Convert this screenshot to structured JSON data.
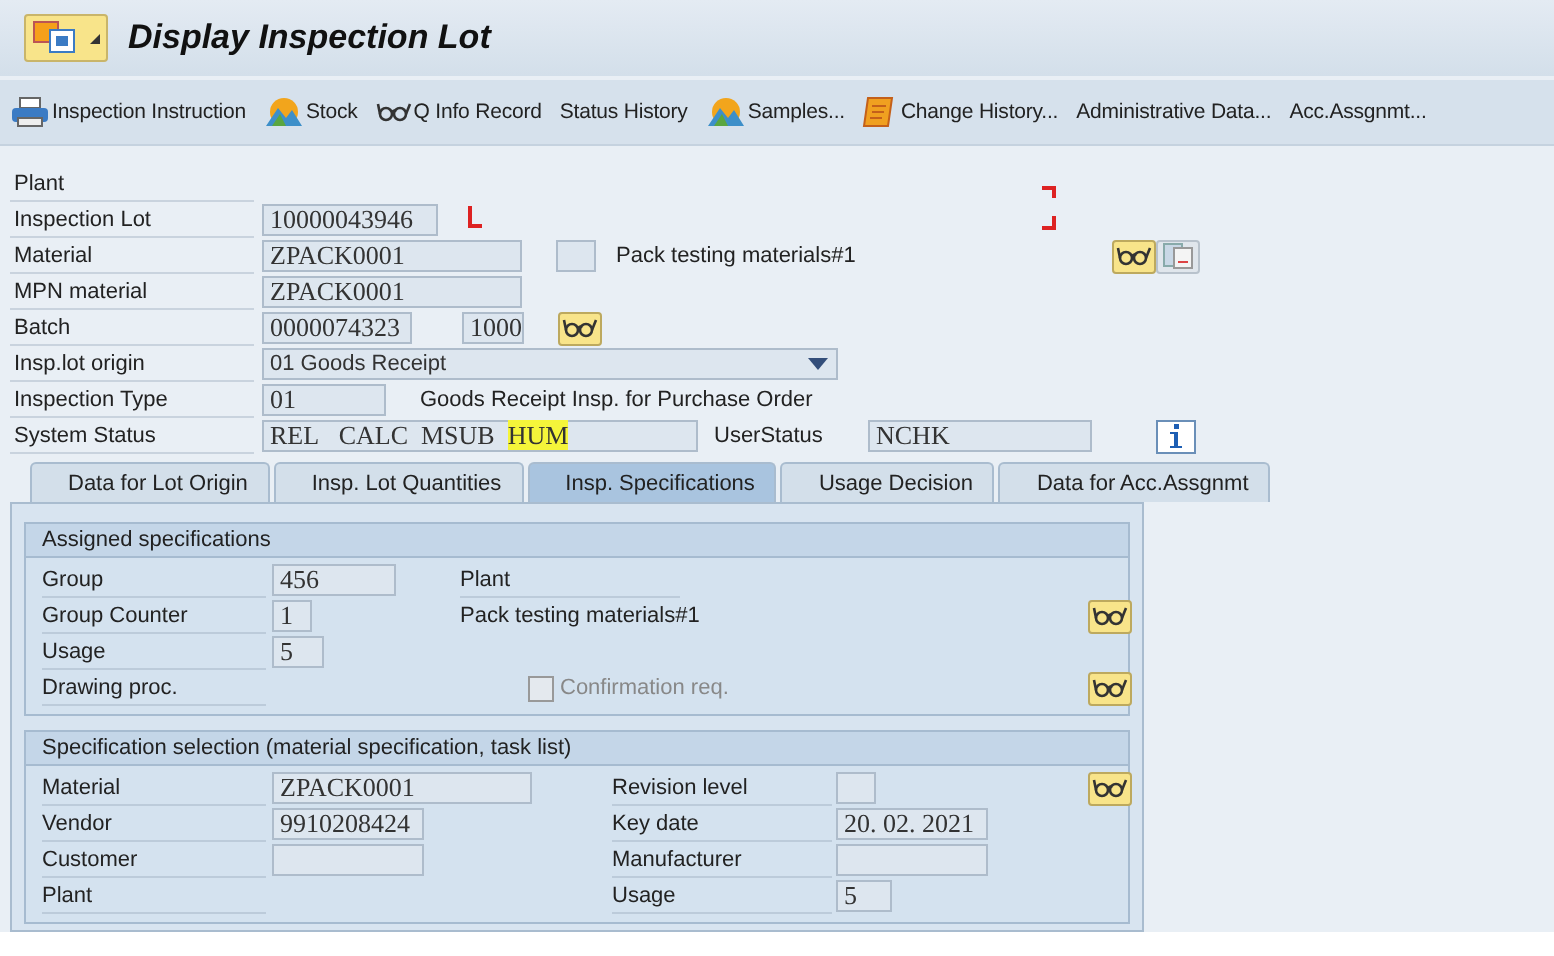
{
  "window": {
    "title": "Display Inspection Lot"
  },
  "toolbar": [
    {
      "label": "Inspection Instruction",
      "kind": "printer"
    },
    {
      "label": "Stock",
      "kind": "mountain"
    },
    {
      "label": "Q Info Record",
      "kind": "glasses"
    },
    {
      "label": "Status History"
    },
    {
      "label": "Samples...",
      "kind": "mountain"
    },
    {
      "label": "Change History...",
      "kind": "scroll"
    },
    {
      "label": "Administrative Data..."
    },
    {
      "label": "Acc.Assgnmt..."
    }
  ],
  "header": {
    "plant": {
      "label": "Plant"
    },
    "inspection_lot": {
      "label": "Inspection Lot",
      "value": "10000043946"
    },
    "material": {
      "label": "Material",
      "value": "ZPACK0001",
      "description": "Pack testing materials#1"
    },
    "mpn_material": {
      "label": "MPN material",
      "value": "ZPACK0001"
    },
    "batch": {
      "label": "Batch",
      "value": "0000074323",
      "plant_value": "1000"
    },
    "insp_lot_origin": {
      "label": "Insp.lot origin",
      "value": "01 Goods Receipt"
    },
    "inspection_type": {
      "label": "Inspection Type",
      "value": "01",
      "description": "Goods Receipt Insp. for Purchase Order"
    },
    "system_status": {
      "label": "System Status",
      "statuses": [
        {
          "text": "REL",
          "highlighted": false
        },
        {
          "text": "CALC",
          "highlighted": false
        },
        {
          "text": "MSUB",
          "highlighted": false
        },
        {
          "text": "HUM",
          "highlighted": true
        }
      ]
    },
    "user_status": {
      "label": "UserStatus",
      "value": "NCHK"
    }
  },
  "tabs": [
    {
      "label": "Data for Lot Origin",
      "selected": false
    },
    {
      "label": "Insp. Lot Quantities",
      "selected": false
    },
    {
      "label": "Insp. Specifications",
      "selected": true
    },
    {
      "label": "Usage Decision",
      "selected": false
    },
    {
      "label": "Data for Acc.Assgnmt",
      "selected": false
    }
  ],
  "assigned_specifications": {
    "title": "Assigned specifications",
    "group": {
      "label": "Group",
      "value": "456"
    },
    "group_counter": {
      "label": "Group Counter",
      "value": "1"
    },
    "usage": {
      "label": "Usage",
      "value": "5"
    },
    "drawing_proc": {
      "label": "Drawing proc."
    },
    "plant": {
      "label": "Plant"
    },
    "description": "Pack testing materials#1",
    "confirmation_req": {
      "label": "Confirmation req.",
      "checked": false,
      "disabled": true
    }
  },
  "specification_selection": {
    "title": "Specification selection (material specification, task list)",
    "material": {
      "label": "Material",
      "value": "ZPACK0001"
    },
    "vendor": {
      "label": "Vendor",
      "value": "9910208424"
    },
    "customer": {
      "label": "Customer"
    },
    "plant": {
      "label": "Plant"
    },
    "revision_level": {
      "label": "Revision level"
    },
    "key_date": {
      "label": "Key date",
      "value": "20. 02. 2021"
    },
    "manufacturer": {
      "label": "Manufacturer"
    },
    "usage": {
      "label": "Usage",
      "value": "5"
    }
  }
}
